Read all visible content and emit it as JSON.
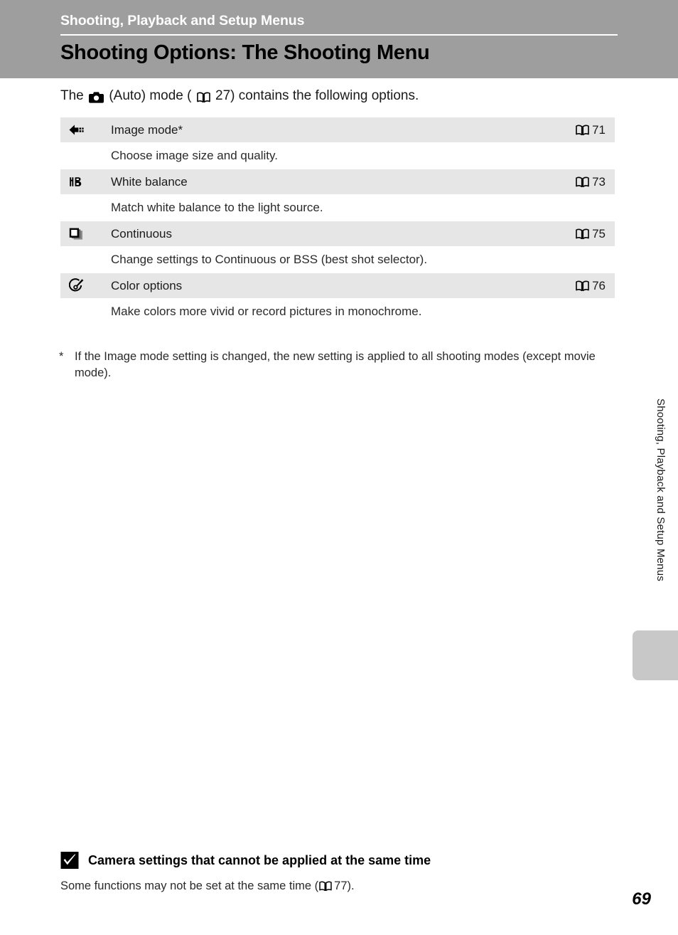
{
  "header": {
    "chapter": "Shooting, Playback and Setup Menus",
    "title": "Shooting Options: The Shooting Menu",
    "band_color": "#9e9e9e",
    "rule_color": "#ffffff"
  },
  "intro": {
    "before_icon": "The",
    "icon": "camera-auto-icon",
    "after_icon": "(Auto) mode (",
    "ref_icon": "book-icon",
    "ref_page": "27",
    "tail": ") contains the following options."
  },
  "options_table": {
    "row_bg": "#e6e6e6",
    "rows": [
      {
        "icon": "image-size-icon",
        "label": "Image mode*",
        "ref_icon": "book-icon",
        "ref_page": "71",
        "description": "Choose image size and quality."
      },
      {
        "icon": "white-balance-icon",
        "label": "White balance",
        "ref_icon": "book-icon",
        "ref_page": "73",
        "description": "Match white balance to the light source."
      },
      {
        "icon": "continuous-icon",
        "label": "Continuous",
        "ref_icon": "book-icon",
        "ref_page": "75",
        "description": "Change settings to Continuous or BSS (best shot selector)."
      },
      {
        "icon": "color-options-icon",
        "label": "Color options",
        "ref_icon": "book-icon",
        "ref_page": "76",
        "description": "Make colors more vivid or record pictures in monochrome."
      }
    ]
  },
  "footnote": {
    "marker": "*",
    "text": "If the Image mode setting is changed, the new setting is applied to all shooting modes (except movie mode)."
  },
  "side": {
    "vertical_label": "Shooting, Playback and Setup Menus",
    "tab_color": "#c8c8c8"
  },
  "note": {
    "icon": "checkbox-filled-icon",
    "heading": "Camera settings that cannot be applied at the same time",
    "body_before": "Some functions may not be set at the same time (",
    "ref_icon": "book-icon",
    "ref_page": "77",
    "body_after": ")."
  },
  "footer": {
    "page_number": "69"
  }
}
